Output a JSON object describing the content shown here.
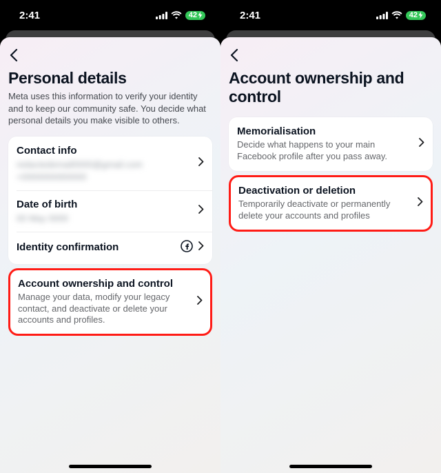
{
  "statusbar": {
    "time": "2:41",
    "battery": "42"
  },
  "left": {
    "title": "Personal details",
    "subtitle": "Meta uses this information to verify your identity and to keep our community safe. You decide what personal details you make visible to others.",
    "rows": {
      "contact": {
        "title": "Contact info",
        "redacted1": "redactedemail0000@gmail.com",
        "redacted2": "+0000000000000"
      },
      "dob": {
        "title": "Date of birth",
        "redacted": "00 May 0000"
      },
      "identity": {
        "title": "Identity confirmation"
      },
      "ownership": {
        "title": "Account ownership and control",
        "sub": "Manage your data, modify your legacy contact, and deactivate or delete your accounts and profiles."
      }
    }
  },
  "right": {
    "title": "Account ownership and control",
    "rows": {
      "memorial": {
        "title": "Memorialisation",
        "sub": "Decide what happens to your main Facebook profile after you pass away."
      },
      "deactivation": {
        "title": "Deactivation or deletion",
        "sub": "Temporarily deactivate or permanently delete your accounts and profiles"
      }
    }
  }
}
